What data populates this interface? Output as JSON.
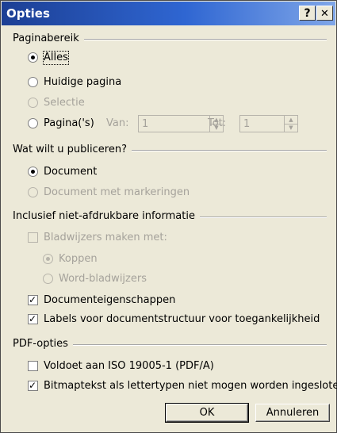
{
  "window": {
    "title": "Opties",
    "help_label": "?",
    "close_label": "✕"
  },
  "sections": {
    "page_range": "Paginabereik",
    "publish": "Wat wilt u publiceren?",
    "nonprint": "Inclusief niet-afdrukbare informatie",
    "pdf": "PDF-opties"
  },
  "page_range": {
    "all": "Alles",
    "current": "Huidige pagina",
    "selection": "Selectie",
    "pages": "Pagina('s)",
    "from_label": "Van:",
    "from_value": "1",
    "to_label": "Tot:",
    "to_value": "1"
  },
  "publish": {
    "document": "Document",
    "markup": "Document met markeringen"
  },
  "nonprint": {
    "bookmarks": "Bladwijzers maken met:",
    "headings": "Koppen",
    "word_bookmarks": "Word-bladwijzers",
    "doc_props": "Documenteigenschappen",
    "struct_tags": "Labels voor documentstructuur voor toegankelijkheid"
  },
  "pdf": {
    "iso": "Voldoet aan ISO 19005-1 (PDF/A)",
    "bitmap": "Bitmaptekst als lettertypen niet mogen worden ingesloten"
  },
  "buttons": {
    "ok": "OK",
    "cancel": "Annuleren"
  }
}
